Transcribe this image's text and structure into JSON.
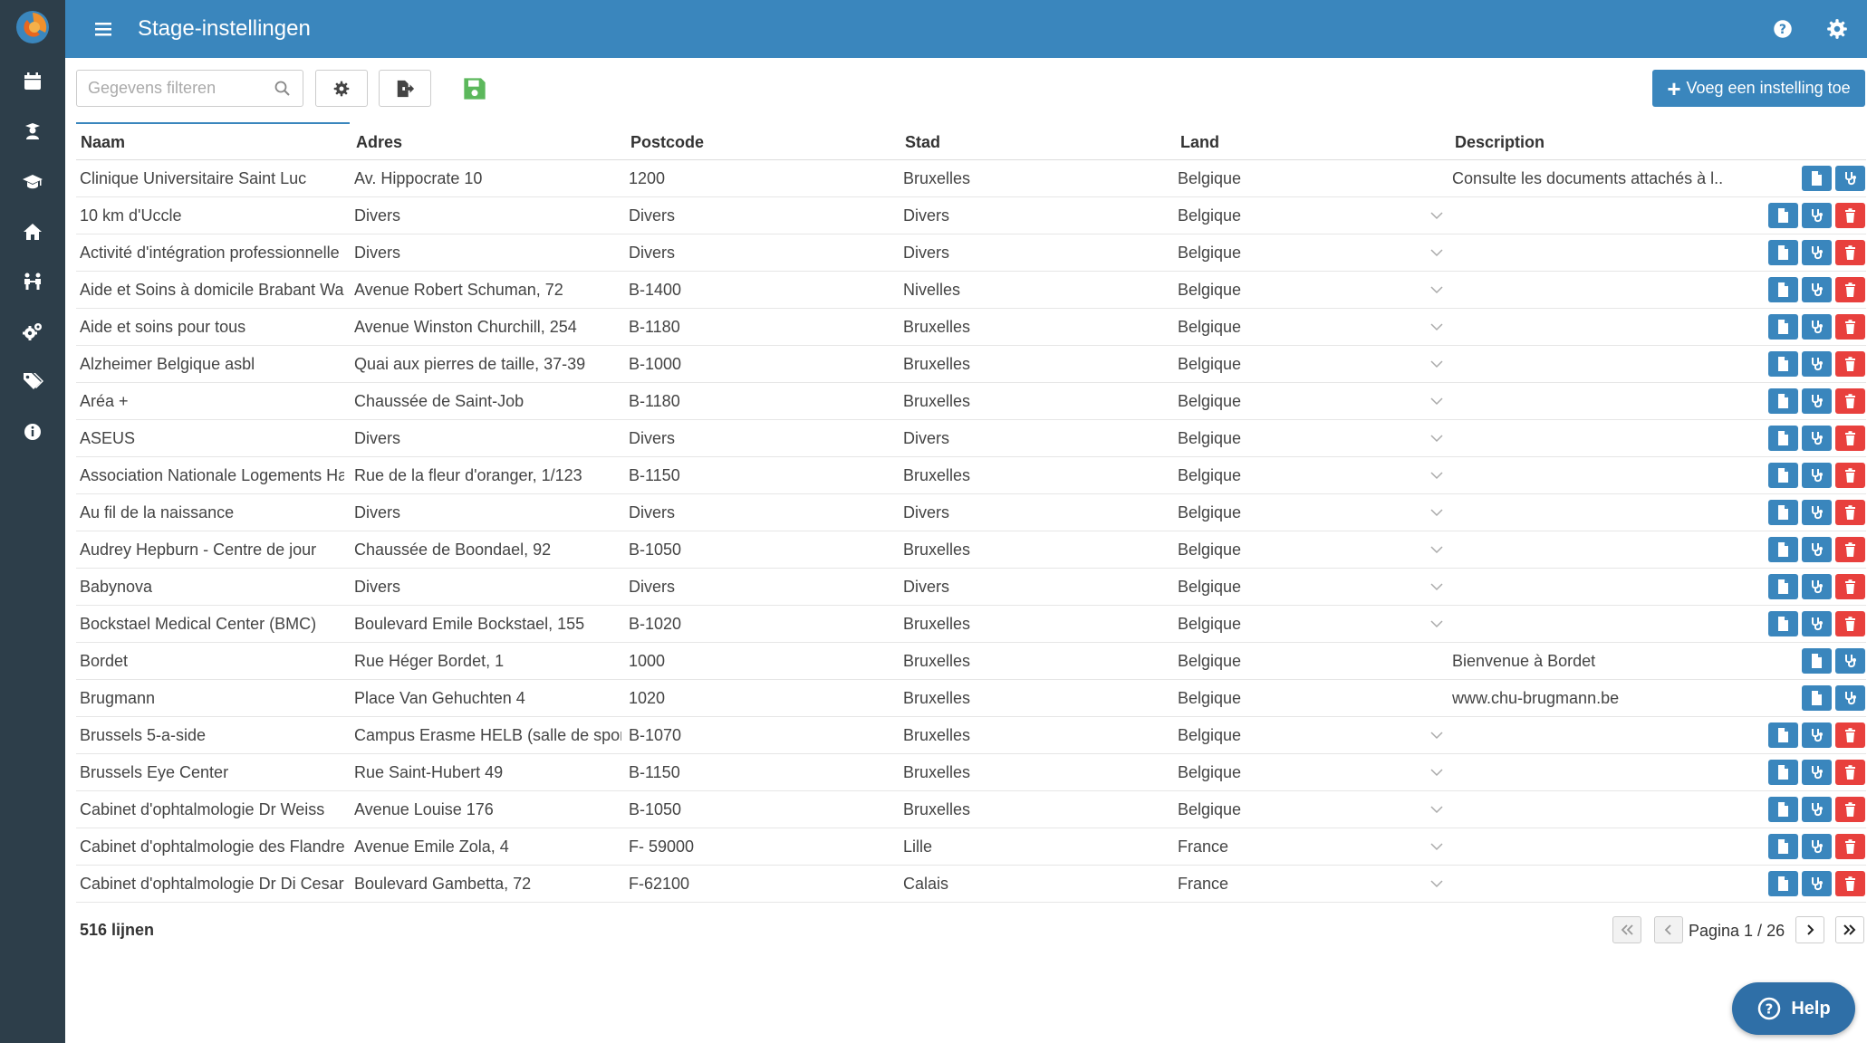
{
  "app": {
    "title": "Stage-instellingen",
    "accent": "#3a86bd",
    "sidebar_bg": "#2d3e4a",
    "danger": "#e8403d"
  },
  "sidebar": {
    "items": [
      {
        "icon": "calendar-icon"
      },
      {
        "icon": "student-icon"
      },
      {
        "icon": "graduation-cap-icon"
      },
      {
        "icon": "home-icon"
      },
      {
        "icon": "people-icon"
      },
      {
        "icon": "gears-icon"
      },
      {
        "icon": "tags-icon"
      },
      {
        "icon": "info-icon"
      }
    ]
  },
  "toolbar": {
    "filter_placeholder": "Gegevens filteren",
    "add_label": "Voeg een instelling toe"
  },
  "table": {
    "columns": [
      "Naam",
      "Adres",
      "Postcode",
      "Stad",
      "Land",
      "Description"
    ],
    "rows": [
      {
        "naam": "Clinique Universitaire Saint Luc",
        "adres": "Av. Hippocrate 10",
        "postcode": "1200",
        "stad": "Bruxelles",
        "land": "Belgique",
        "description": "Consulte les documents attachés à l...",
        "expandable": false,
        "deletable": false
      },
      {
        "naam": "10 km d'Uccle",
        "adres": "Divers",
        "postcode": "Divers",
        "stad": "Divers",
        "land": "Belgique",
        "description": "",
        "expandable": true,
        "deletable": true
      },
      {
        "naam": "Activité d'intégration professionnelle",
        "adres": "Divers",
        "postcode": "Divers",
        "stad": "Divers",
        "land": "Belgique",
        "description": "",
        "expandable": true,
        "deletable": true
      },
      {
        "naam": "Aide et Soins à domicile Brabant Wa",
        "adres": "Avenue Robert Schuman, 72",
        "postcode": "B-1400",
        "stad": "Nivelles",
        "land": "Belgique",
        "description": "",
        "expandable": true,
        "deletable": true
      },
      {
        "naam": "Aide et soins pour tous",
        "adres": "Avenue Winston Churchill, 254",
        "postcode": "B-1180",
        "stad": "Bruxelles",
        "land": "Belgique",
        "description": "",
        "expandable": true,
        "deletable": true
      },
      {
        "naam": "Alzheimer Belgique asbl",
        "adres": "Quai aux pierres de taille, 37-39",
        "postcode": "B-1000",
        "stad": "Bruxelles",
        "land": "Belgique",
        "description": "",
        "expandable": true,
        "deletable": true
      },
      {
        "naam": "Aréa +",
        "adres": "Chaussée de Saint-Job",
        "postcode": "B-1180",
        "stad": "Bruxelles",
        "land": "Belgique",
        "description": "",
        "expandable": true,
        "deletable": true
      },
      {
        "naam": "ASEUS",
        "adres": "Divers",
        "postcode": "Divers",
        "stad": "Divers",
        "land": "Belgique",
        "description": "",
        "expandable": true,
        "deletable": true
      },
      {
        "naam": "Association Nationale Logements Ha",
        "adres": "Rue de la fleur d'oranger, 1/123",
        "postcode": "B-1150",
        "stad": "Bruxelles",
        "land": "Belgique",
        "description": "",
        "expandable": true,
        "deletable": true
      },
      {
        "naam": "Au fil de la naissance",
        "adres": "Divers",
        "postcode": "Divers",
        "stad": "Divers",
        "land": "Belgique",
        "description": "",
        "expandable": true,
        "deletable": true
      },
      {
        "naam": "Audrey Hepburn - Centre de jour",
        "adres": "Chaussée de Boondael, 92",
        "postcode": "B-1050",
        "stad": "Bruxelles",
        "land": "Belgique",
        "description": "",
        "expandable": true,
        "deletable": true
      },
      {
        "naam": "Babynova",
        "adres": "Divers",
        "postcode": "Divers",
        "stad": "Divers",
        "land": "Belgique",
        "description": "",
        "expandable": true,
        "deletable": true
      },
      {
        "naam": "Bockstael Medical Center (BMC)",
        "adres": "Boulevard Emile Bockstael, 155",
        "postcode": "B-1020",
        "stad": "Bruxelles",
        "land": "Belgique",
        "description": "",
        "expandable": true,
        "deletable": true
      },
      {
        "naam": "Bordet",
        "adres": "Rue Héger Bordet, 1",
        "postcode": "1000",
        "stad": "Bruxelles",
        "land": "Belgique",
        "description": "Bienvenue à Bordet",
        "expandable": false,
        "deletable": false
      },
      {
        "naam": "Brugmann",
        "adres": "Place Van Gehuchten 4",
        "postcode": "1020",
        "stad": "Bruxelles",
        "land": "Belgique",
        "description": "www.chu-brugmann.be",
        "expandable": false,
        "deletable": false
      },
      {
        "naam": "Brussels 5-a-side",
        "adres": "Campus Erasme HELB (salle de spor",
        "postcode": "B-1070",
        "stad": "Bruxelles",
        "land": "Belgique",
        "description": "",
        "expandable": true,
        "deletable": true
      },
      {
        "naam": "Brussels Eye Center",
        "adres": "Rue Saint-Hubert 49",
        "postcode": "B-1150",
        "stad": "Bruxelles",
        "land": "Belgique",
        "description": "",
        "expandable": true,
        "deletable": true
      },
      {
        "naam": "Cabinet d'ophtalmologie  Dr Weiss",
        "adres": "Avenue Louise 176",
        "postcode": "B-1050",
        "stad": "Bruxelles",
        "land": "Belgique",
        "description": "",
        "expandable": true,
        "deletable": true
      },
      {
        "naam": "Cabinet d'ophtalmologie des Flandre",
        "adres": "Avenue Emile Zola, 4",
        "postcode": "F- 59000",
        "stad": "Lille",
        "land": "France",
        "description": "",
        "expandable": true,
        "deletable": true
      },
      {
        "naam": "Cabinet d'ophtalmologie Dr Di Cesare",
        "adres": "Boulevard Gambetta, 72",
        "postcode": "F-62100",
        "stad": "Calais",
        "land": "France",
        "description": "",
        "expandable": true,
        "deletable": true
      }
    ]
  },
  "footer": {
    "row_count": "516 lijnen",
    "page_label": "Pagina 1 / 26"
  },
  "help": {
    "label": "Help"
  }
}
